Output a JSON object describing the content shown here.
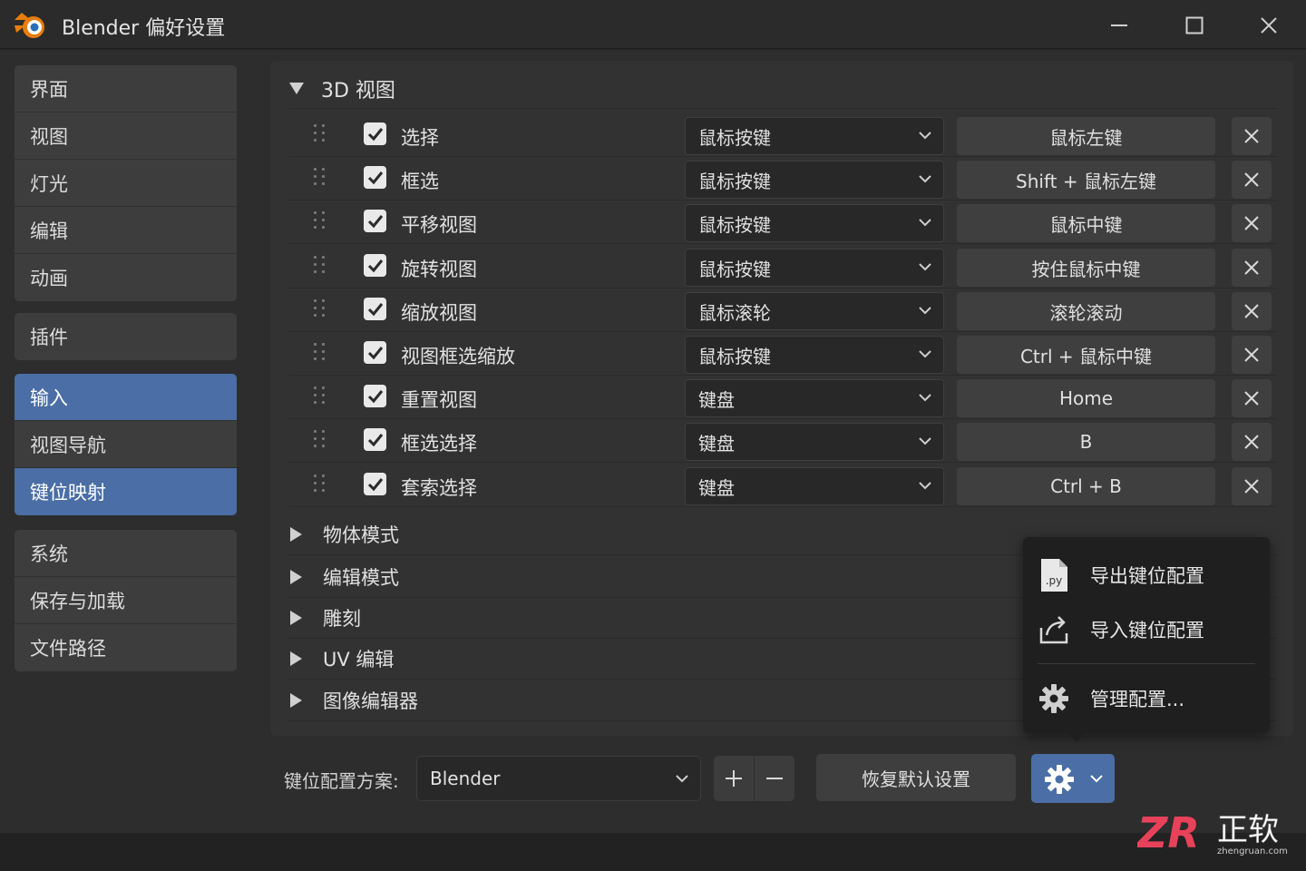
{
  "window": {
    "title": "Blender 偏好设置"
  },
  "sidebar": {
    "groups": [
      [
        "界面",
        "视图",
        "灯光",
        "编辑",
        "动画"
      ],
      [
        "插件"
      ],
      [
        "输入",
        "视图导航",
        "键位映射"
      ],
      [
        "系统",
        "保存与加载",
        "文件路径"
      ]
    ],
    "active_items": [
      "输入",
      "键位映射"
    ]
  },
  "section": {
    "title": "3D 视图",
    "rows": [
      {
        "label": "选择",
        "checked": true,
        "type": "鼠标按键",
        "key": "鼠标左键"
      },
      {
        "label": "框选",
        "checked": true,
        "type": "鼠标按键",
        "key": "Shift + 鼠标左键"
      },
      {
        "label": "平移视图",
        "checked": true,
        "type": "鼠标按键",
        "key": "鼠标中键"
      },
      {
        "label": "旋转视图",
        "checked": true,
        "type": "鼠标按键",
        "key": "按住鼠标中键"
      },
      {
        "label": "缩放视图",
        "checked": true,
        "type": "鼠标滚轮",
        "key": "滚轮滚动"
      },
      {
        "label": "视图框选缩放",
        "checked": true,
        "type": "鼠标按键",
        "key": "Ctrl + 鼠标中键"
      },
      {
        "label": "重置视图",
        "checked": true,
        "type": "键盘",
        "key": "Home"
      },
      {
        "label": "框选选择",
        "checked": true,
        "type": "键盘",
        "key": "B"
      },
      {
        "label": "套索选择",
        "checked": true,
        "type": "键盘",
        "key": "Ctrl + B"
      }
    ]
  },
  "collapsed_sections": [
    "物体模式",
    "编辑模式",
    "雕刻",
    "UV 编辑",
    "图像编辑器"
  ],
  "toolbar": {
    "scheme_label": "键位配置方案:",
    "scheme_value": "Blender",
    "restore_label": "恢复默认设置"
  },
  "popup_menu": {
    "items": [
      {
        "label": "导出键位配置",
        "icon": "python-file-icon",
        "icon_text": ".py"
      },
      {
        "label": "导入键位配置",
        "icon": "import-icon"
      },
      {
        "label": "管理配置...",
        "icon": "gear-icon"
      }
    ]
  },
  "watermark": {
    "logo_text": "ZR",
    "brand": "正软",
    "url": "zhengruan.com"
  },
  "colors": {
    "accent": "#4a6ea5",
    "panel": "#323232",
    "background": "#2d2d2d"
  }
}
